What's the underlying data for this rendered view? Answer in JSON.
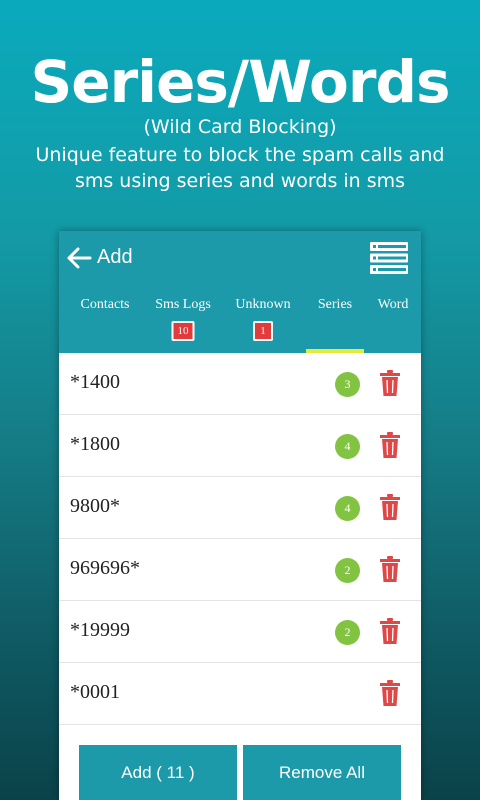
{
  "promo": {
    "title": "Series/Words",
    "subtitle": "(Wild Card Blocking)",
    "description": "Unique feature to block the spam calls and sms using series and words in sms"
  },
  "appbar": {
    "title": "Add",
    "back_icon": "arrow-left-icon",
    "menu_icon": "list-menu-icon"
  },
  "tabs": [
    {
      "label": "Contacts",
      "badge": null
    },
    {
      "label": "Sms Logs",
      "badge": "10"
    },
    {
      "label": "Unknown",
      "badge": "1"
    },
    {
      "label": "Series",
      "badge": null,
      "selected": true
    },
    {
      "label": "Word",
      "badge": null
    }
  ],
  "list": [
    {
      "value": "*1400",
      "count": "3"
    },
    {
      "value": "*1800",
      "count": "4"
    },
    {
      "value": "9800*",
      "count": "4"
    },
    {
      "value": "969696*",
      "count": "2"
    },
    {
      "value": "*19999",
      "count": "2"
    },
    {
      "value": "*0001",
      "count": null
    }
  ],
  "actions": {
    "add_label": "Add ( 11 )",
    "remove_all_label": "Remove All"
  },
  "colors": {
    "primary": "#1d9aaa",
    "tab_indicator": "#e6ea3c",
    "badge_red": "#e23b3b",
    "count_green": "#82c341",
    "trash_red": "#e04848"
  }
}
